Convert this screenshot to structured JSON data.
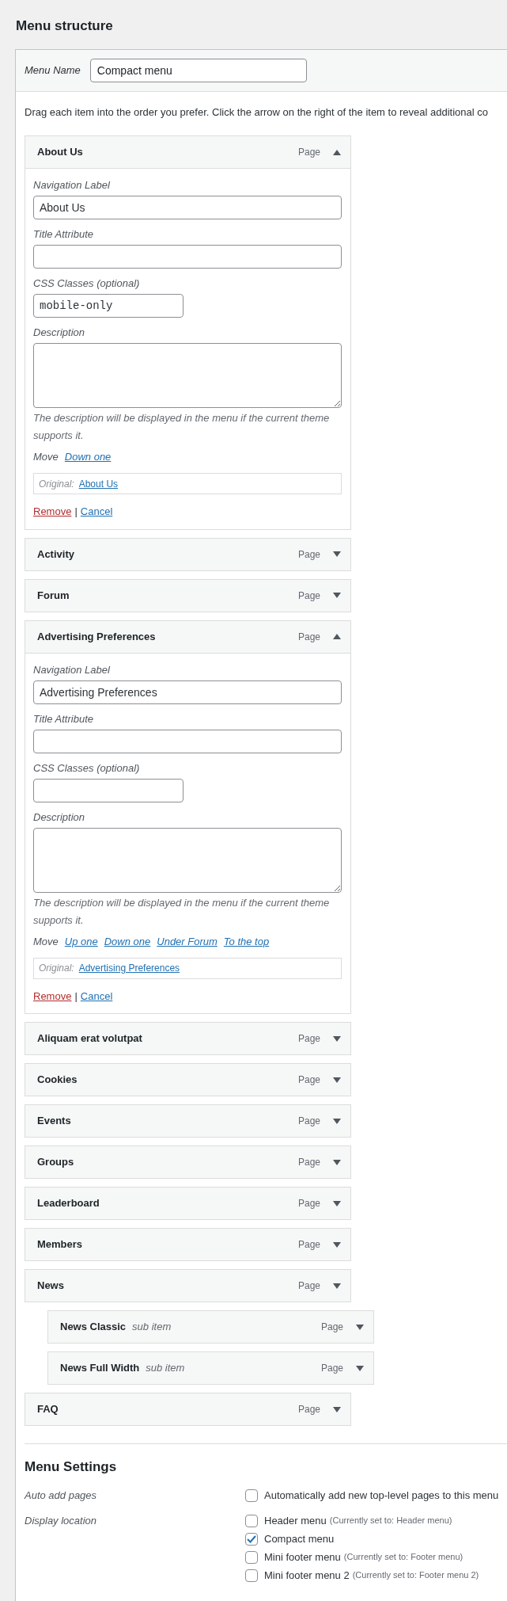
{
  "heading": "Menu structure",
  "menu_name": {
    "label": "Menu Name",
    "value": "Compact menu"
  },
  "instructions": "Drag each item into the order you prefer. Click the arrow on the right of the item to reveal additional co",
  "items": [
    {
      "title": "About Us",
      "type": "Page",
      "expanded": true,
      "details": {
        "nav_label": {
          "label": "Navigation Label",
          "value": "About Us"
        },
        "title_attribute": {
          "label": "Title Attribute"
        },
        "css_classes": {
          "label": "CSS Classes (optional)",
          "value": "mobile-only"
        },
        "description": {
          "label": "Description"
        },
        "description_note": "The description will be displayed in the menu if the current theme supports it.",
        "move": {
          "label": "Move",
          "links": [
            "Down one"
          ]
        },
        "original": {
          "label": "Original:",
          "link": "About Us"
        },
        "remove": "Remove",
        "separator": "|",
        "cancel": "Cancel"
      }
    },
    {
      "title": "Activity",
      "type": "Page",
      "expanded": false
    },
    {
      "title": "Forum",
      "type": "Page",
      "expanded": false
    },
    {
      "title": "Advertising Preferences",
      "type": "Page",
      "expanded": true,
      "details": {
        "nav_label": {
          "label": "Navigation Label",
          "value": "Advertising Preferences"
        },
        "title_attribute": {
          "label": "Title Attribute"
        },
        "css_classes": {
          "label": "CSS Classes (optional)"
        },
        "description": {
          "label": "Description"
        },
        "description_note": "The description will be displayed in the menu if the current theme supports it.",
        "move": {
          "label": "Move",
          "links": [
            "Up one",
            "Down one",
            "Under Forum",
            "To the top"
          ]
        },
        "original": {
          "label": "Original:",
          "link": "Advertising Preferences"
        },
        "remove": "Remove",
        "separator": "|",
        "cancel": "Cancel"
      }
    },
    {
      "title": "Aliquam erat volutpat",
      "type": "Page",
      "expanded": false
    },
    {
      "title": "Cookies",
      "type": "Page",
      "expanded": false
    },
    {
      "title": "Events",
      "type": "Page",
      "expanded": false
    },
    {
      "title": "Groups",
      "type": "Page",
      "expanded": false
    },
    {
      "title": "Leaderboard",
      "type": "Page",
      "expanded": false
    },
    {
      "title": "Members",
      "type": "Page",
      "expanded": false
    },
    {
      "title": "News",
      "type": "Page",
      "expanded": false,
      "children": [
        {
          "title": "News Classic",
          "sub_label": "sub item",
          "type": "Page",
          "expanded": false
        },
        {
          "title": "News Full Width",
          "sub_label": "sub item",
          "type": "Page",
          "expanded": false
        }
      ]
    },
    {
      "title": "FAQ",
      "type": "Page",
      "expanded": false
    }
  ],
  "settings": {
    "title": "Menu Settings",
    "rows": [
      {
        "label": "Auto add pages",
        "options": [
          {
            "label": "Automatically add new top-level pages to this menu",
            "checked": false
          }
        ]
      },
      {
        "label": "Display location",
        "options": [
          {
            "label": "Header menu",
            "note": "(Currently set to: Header menu)",
            "checked": false
          },
          {
            "label": "Compact menu",
            "checked": true
          },
          {
            "label": "Mini footer menu",
            "note": "(Currently set to: Footer menu)",
            "checked": false
          },
          {
            "label": "Mini footer menu 2",
            "note": "(Currently set to: Footer menu 2)",
            "checked": false
          }
        ]
      }
    ]
  }
}
